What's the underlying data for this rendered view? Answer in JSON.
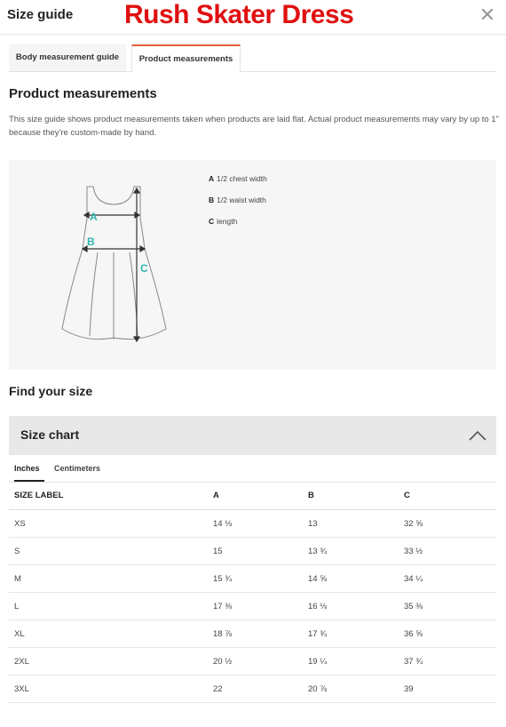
{
  "header": {
    "title": "Size guide",
    "brand": "Rush Skater Dress",
    "close_icon": "close-icon",
    "brand_color": "#e01010"
  },
  "tabs": [
    "Body measurement guide",
    "Product measurements"
  ],
  "product_measurements": {
    "heading": "Product measurements",
    "description": "This size guide shows product measurements taken when products are laid flat. Actual product measurements may vary by up to 1\" because they're custom-made by hand.",
    "markers": [
      "A",
      "B",
      "C"
    ],
    "legend": [
      {
        "key": "A",
        "text": "1/2 chest width"
      },
      {
        "key": "B",
        "text": "1/2 waist width"
      },
      {
        "key": "C",
        "text": "length"
      }
    ],
    "marker_color": "#2fb5b0"
  },
  "find_size": {
    "heading": "Find your size",
    "chart_label": "Size chart",
    "chevron_icon": "chevron-up-icon",
    "unit_tabs": [
      "Inches",
      "Centimeters"
    ]
  },
  "size_chart": {
    "headers": [
      "SIZE LABEL",
      "A",
      "B",
      "C"
    ],
    "rows": [
      [
        "XS",
        "14 ⅛",
        "13",
        "32 ⅝"
      ],
      [
        "S",
        "15",
        "13 ¾",
        "33 ½"
      ],
      [
        "M",
        "15 ¾",
        "14 ⅝",
        "34 ¼"
      ],
      [
        "L",
        "17 ⅜",
        "16 ⅛",
        "35 ⅜"
      ],
      [
        "XL",
        "18 ⅞",
        "17 ¾",
        "36 ⅝"
      ],
      [
        "2XL",
        "20 ½",
        "19 ¼",
        "37 ¾"
      ],
      [
        "3XL",
        "22",
        "20 ⅞",
        "39"
      ]
    ]
  }
}
